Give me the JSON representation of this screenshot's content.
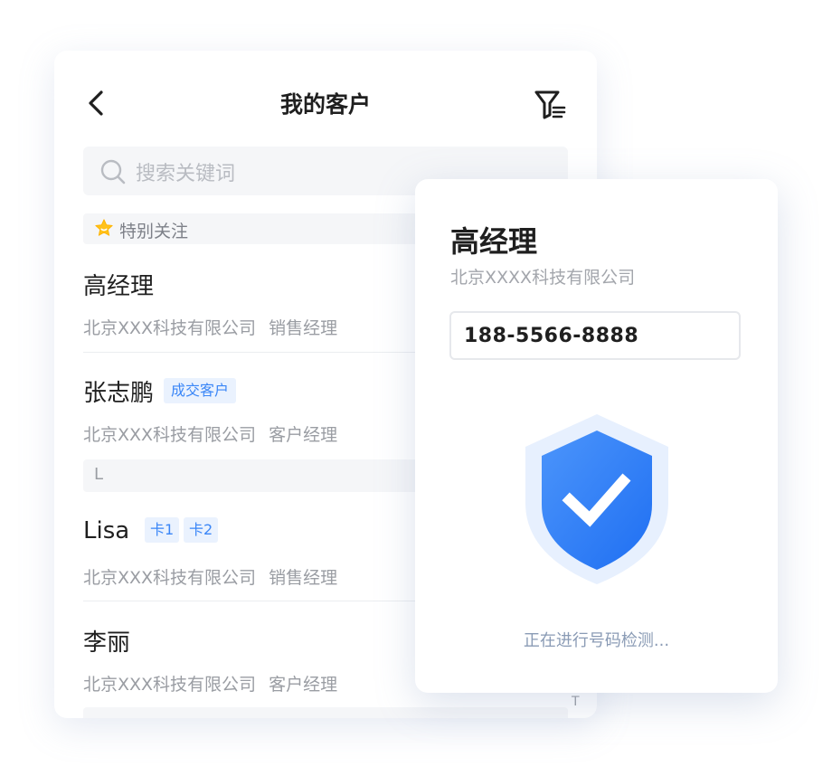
{
  "list_screen": {
    "title": "我的客户",
    "search": {
      "placeholder": "搜索关键词"
    },
    "section_favorites": {
      "label": "特别关注"
    },
    "section_l": {
      "letter": "L"
    },
    "index_letter": "T",
    "contacts": [
      {
        "name": "高经理",
        "company": "北京XXX科技有限公司",
        "role": "销售经理",
        "tags": []
      },
      {
        "name": "张志鹏",
        "company": "北京XXX科技有限公司",
        "role": "客户经理",
        "tags": [
          "成交客户"
        ]
      },
      {
        "name": "Lisa",
        "company": "北京XXX科技有限公司",
        "role": "销售经理",
        "tags": [
          "卡1",
          "卡2"
        ]
      },
      {
        "name": "李丽",
        "company": "北京XXX科技有限公司",
        "role": "客户经理",
        "tags": []
      }
    ]
  },
  "check_card": {
    "name": "高经理",
    "company": "北京XXXX科技有限公司",
    "phone": "188-5566-8888",
    "status": "正在进行号码检测..."
  },
  "icons": {
    "back": "chevron-left-icon",
    "filter": "filter-icon",
    "search": "search-icon",
    "favorite": "star-icon",
    "shield": "shield-check-icon"
  },
  "colors": {
    "accent": "#2f7cf6",
    "tag_text": "#3a86f7",
    "tag_bg": "#eaf2fe",
    "star": "#ffc21a"
  }
}
